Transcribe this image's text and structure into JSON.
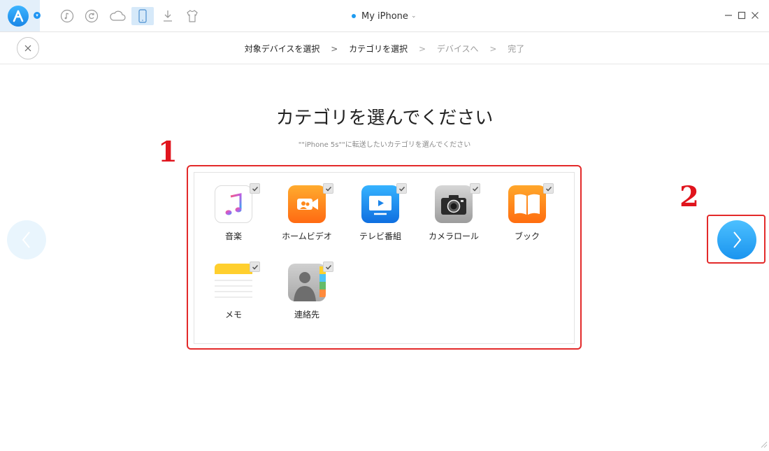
{
  "header": {
    "device_name": "My iPhone",
    "toolbar": [
      {
        "name": "music-icon",
        "active": false
      },
      {
        "name": "restore-icon",
        "active": false
      },
      {
        "name": "cloud-icon",
        "active": false
      },
      {
        "name": "phone-icon",
        "active": true
      },
      {
        "name": "download-icon",
        "active": false
      },
      {
        "name": "tshirt-icon",
        "active": false
      }
    ],
    "window_controls": [
      "minimize-icon",
      "maximize-icon",
      "close-icon"
    ]
  },
  "wizard": {
    "steps": [
      {
        "label": "対象デバイスを選択",
        "state": "done"
      },
      {
        "label": "カテゴリを選択",
        "state": "current"
      },
      {
        "label": "デバイスへ",
        "state": "todo"
      },
      {
        "label": "完了",
        "state": "todo"
      }
    ],
    "separator": ">"
  },
  "main": {
    "title": "カテゴリを選んでください",
    "subtitle": "\"\"iPhone 5s\"\"に転送したいカテゴリを選んでください",
    "categories": [
      {
        "label": "音楽",
        "icon": "music-app-icon",
        "checked": true
      },
      {
        "label": "ホームビデオ",
        "icon": "home-video-icon",
        "checked": true
      },
      {
        "label": "テレビ番組",
        "icon": "tv-app-icon",
        "checked": true
      },
      {
        "label": "カメラロール",
        "icon": "camera-icon",
        "checked": true
      },
      {
        "label": "ブック",
        "icon": "books-icon",
        "checked": true
      },
      {
        "label": "メモ",
        "icon": "notes-icon",
        "checked": true
      },
      {
        "label": "連絡先",
        "icon": "contacts-icon",
        "checked": true
      }
    ]
  },
  "annotations": {
    "one": "1",
    "two": "2"
  },
  "colors": {
    "accent": "#1e9bf0",
    "highlight": "#e32a2a"
  }
}
